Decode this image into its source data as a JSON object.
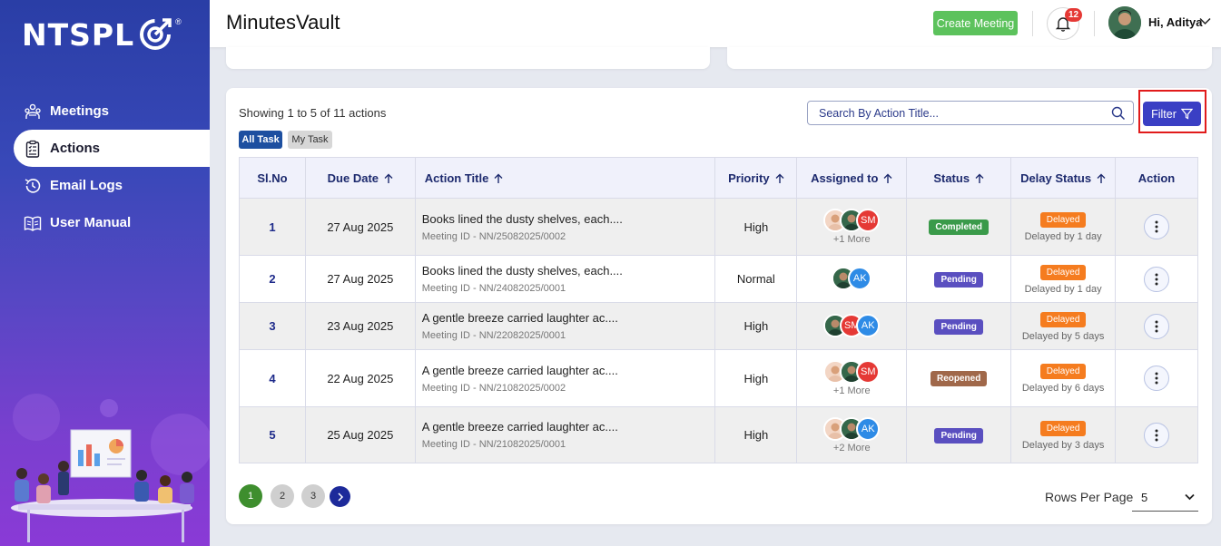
{
  "brand": {
    "name": "NTSPL",
    "reg": "®"
  },
  "sidebar": {
    "items": [
      {
        "label": "Meetings",
        "icon": "meetings-icon"
      },
      {
        "label": "Actions",
        "icon": "clipboard-icon",
        "active": true
      },
      {
        "label": "Email Logs",
        "icon": "history-icon"
      },
      {
        "label": "User Manual",
        "icon": "book-icon"
      }
    ]
  },
  "header": {
    "title": "MinutesVault",
    "create_label": "Create Meeting",
    "notifications": "12",
    "greeting": "Hi, Aditya"
  },
  "main": {
    "showing": "Showing 1 to 5 of 11 actions",
    "tabs": {
      "all": "All Task",
      "my": "My Task"
    },
    "search_placeholder": "Search By Action Title...",
    "filter_label": "Filter",
    "columns": [
      "Sl.No",
      "Due Date",
      "Action Title",
      "Priority",
      "Assigned to",
      "Status",
      "Delay Status",
      "Action"
    ],
    "rows": [
      {
        "sl": "1",
        "due": "27 Aug 2025",
        "title": "Books lined the dusty shelves, each....",
        "meeting": "Meeting ID - NN/25082025/0002",
        "priority": "High",
        "more": "+1 More",
        "status": "Completed",
        "delay": "Delayed",
        "delay_by": "Delayed by 1 day"
      },
      {
        "sl": "2",
        "due": "27 Aug 2025",
        "title": "Books lined the dusty shelves, each....",
        "meeting": "Meeting ID - NN/24082025/0001",
        "priority": "Normal",
        "more": "",
        "status": "Pending",
        "delay": "Delayed",
        "delay_by": "Delayed by 1 day"
      },
      {
        "sl": "3",
        "due": "23 Aug 2025",
        "title": "A gentle breeze carried laughter ac....",
        "meeting": "Meeting ID - NN/22082025/0001",
        "priority": "High",
        "more": "",
        "status": "Pending",
        "delay": "Delayed",
        "delay_by": "Delayed by 5 days"
      },
      {
        "sl": "4",
        "due": "22 Aug 2025",
        "title": "A gentle breeze carried laughter ac....",
        "meeting": "Meeting ID - NN/21082025/0002",
        "priority": "High",
        "more": "+1 More",
        "status": "Reopened",
        "delay": "Delayed",
        "delay_by": "Delayed by 6 days"
      },
      {
        "sl": "5",
        "due": "25 Aug 2025",
        "title": "A gentle breeze carried laughter ac....",
        "meeting": "Meeting ID - NN/21082025/0001",
        "priority": "High",
        "more": "+2 More",
        "status": "Pending",
        "delay": "Delayed",
        "delay_by": "Delayed by 3 days"
      }
    ],
    "avatars": {
      "sm": "SM",
      "ak": "AK"
    },
    "pagination": [
      "1",
      "2",
      "3"
    ],
    "rows_per_page_label": "Rows Per Page",
    "rows_per_page": "5"
  },
  "colors": {
    "accent": "#3a3fc4",
    "create": "#5cc25c",
    "completed": "#3a9a4a",
    "pending": "#5a4fc0",
    "reopened": "#a0684a",
    "delayed": "#f57c1f"
  }
}
